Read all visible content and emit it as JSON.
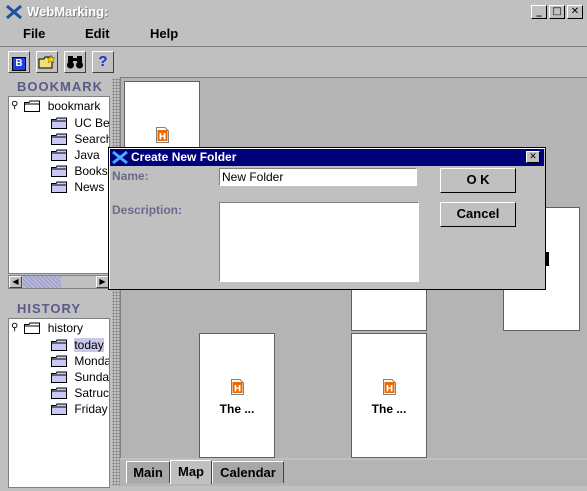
{
  "window": {
    "title": "WebMarking:"
  },
  "menu": [
    "File",
    "Edit",
    "Help"
  ],
  "toolbar": {
    "bookmark_button": "B",
    "help_button": "?"
  },
  "bookmark_panel": {
    "title": "BOOKMARK",
    "root": "bookmark",
    "items": [
      "UC Be",
      "Search",
      "Java",
      "Books",
      "News"
    ]
  },
  "history_panel": {
    "title": "HISTORY",
    "root": "history",
    "items": [
      "today",
      "Monda",
      "Sunda",
      "Satruc",
      "Friday"
    ],
    "selected": "today"
  },
  "canvas": {
    "doc_icon_letter": "H",
    "cards": [
      {
        "title": ""
      },
      {
        "title": ""
      },
      {
        "title": ""
      },
      {
        "title": "The ..."
      },
      {
        "title": "The ..."
      }
    ]
  },
  "tabs": [
    {
      "label": "Main",
      "active": false
    },
    {
      "label": "Map",
      "active": true
    },
    {
      "label": "Calendar",
      "active": false
    }
  ],
  "dialog": {
    "title": "Create New Folder",
    "name_label": "Name:",
    "name_value": "New Folder",
    "description_label": "Description:",
    "description_value": "",
    "ok_label": "O K",
    "cancel_label": "Cancel"
  },
  "colors": {
    "dialog_title_bg": "#00007b",
    "panel_title_text": "#5a5a8a",
    "selection": "#c8c8e8",
    "doc_icon": "#e86a00"
  }
}
